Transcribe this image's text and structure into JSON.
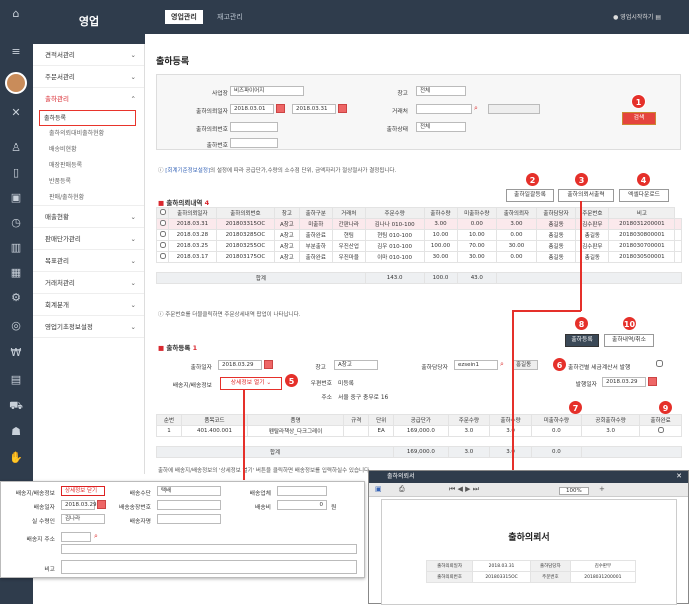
{
  "app": {
    "logo": "영업",
    "tabs": [
      "영업관리",
      "재고관리"
    ],
    "action": "영업시작하기"
  },
  "sidebar": [
    {
      "label": "견적서관리",
      "items": []
    },
    {
      "label": "주문서관리",
      "items": []
    },
    {
      "label": "출하관리",
      "items": [
        "출하등록",
        "출하의뢰대비출하현황",
        "배송비현황",
        "매장판매등록",
        "반품등록",
        "판매/출하현황"
      ]
    },
    {
      "label": "매출현황",
      "items": []
    },
    {
      "label": "판매단가관리",
      "items": []
    },
    {
      "label": "목표관리",
      "items": []
    },
    {
      "label": "거래처관리",
      "items": []
    },
    {
      "label": "회계분개",
      "items": []
    },
    {
      "label": "영업기초정보설정",
      "items": []
    }
  ],
  "page": {
    "title": "출하등록"
  },
  "search": {
    "biz_label": "사업장",
    "biz_value": "비즈파이어지",
    "warehouse_label": "창고",
    "warehouse_value": "전체",
    "date_label": "출하의뢰일자",
    "date_from": "2018.03.01",
    "date_to": "2018.03.31",
    "client_label": "거래처",
    "req_no_label": "출하의뢰번호",
    "status_label": "출하상태",
    "status_value": "전체",
    "ship_no_label": "출하번호",
    "search_btn": "검색"
  },
  "note1": {
    "link": "[회계기준정보설정]",
    "text": "의 설정에 따라 공급단가,수량의 소수점 단위, 금액자리가 절상절사가 결정됩니다."
  },
  "buttons": {
    "bulk": "출하일괄등록",
    "print": "출하의뢰서출력",
    "excel": "엑셀다운로드",
    "register": "출하등록",
    "cancel": "출하내역/취소"
  },
  "list": {
    "title": "출하의뢰내역",
    "count": "4",
    "headers": [
      "출하의뢰일자",
      "출하의뢰번호",
      "창고",
      "출하구분",
      "거래처",
      "주문수량",
      "출하수량",
      "미출하수량",
      "출하의뢰자",
      "출하담당자",
      "주문번호",
      "비고"
    ],
    "rows": [
      [
        "2018.03.31",
        "201803315OC",
        "A창고",
        "미출하",
        "간판나라",
        "김나나 010-100",
        "3.00",
        "0.00",
        "3.00",
        "총길동",
        "김수판무",
        "2018031200001",
        ""
      ],
      [
        "2018.03.28",
        "201803285OC",
        "A창고",
        "출하완료",
        "현팀",
        "현팀 010-100",
        "10.00",
        "10.00",
        "0.00",
        "총길동",
        "총길동",
        "2018030800001",
        ""
      ],
      [
        "2018.03.25",
        "201803255OC",
        "A창고",
        "부분출하",
        "우진산업",
        "김우 010-100",
        "100.00",
        "70.00",
        "30.00",
        "총길동",
        "김수판무",
        "2018030700001",
        ""
      ],
      [
        "2018.03.17",
        "201803175OC",
        "A창고",
        "출하완료",
        "우진마을",
        "이마 010-100",
        "30.00",
        "30.00",
        "0.00",
        "총길동",
        "총길동",
        "2018030500001",
        ""
      ]
    ],
    "total_label": "합계",
    "total": [
      "143.0",
      "100.0",
      "43.0"
    ]
  },
  "note2": "주문번호를 더블클릭하면 주문상세내역 팝업이 나타납니다.",
  "reg": {
    "title": "출하등록",
    "count": "1",
    "date_label": "출하일자",
    "date": "2018.03.29",
    "wh_label": "창고",
    "wh_value": "A창고",
    "mgr_label": "출하담당자",
    "mgr_id": "ezsein1",
    "mgr_name": "홍길동",
    "tax_label": "출하건별 세금계산서 발행",
    "issue_label": "발행일자",
    "issue_date": "2018.03.29",
    "delivery_label": "배송지/배송정보",
    "detail_btn": "상세정보 열기",
    "post_label": "우편번호",
    "post_value": "미등록",
    "addr_label": "주소",
    "addr_value": "서울 중구 충무로 16"
  },
  "items": {
    "headers": [
      "순번",
      "품목코드",
      "품명",
      "규격",
      "단위",
      "공급단가",
      "주문수량",
      "출하수량",
      "미출하수량",
      "공회출하수량",
      "출하완료"
    ],
    "row": [
      "1",
      "401.400.001",
      "펜탈라책상_다크그레이",
      "",
      "EA",
      "169,000.0",
      "3.0",
      "3.0",
      "0.0",
      "3.0",
      ""
    ],
    "total_label": "합계",
    "total": [
      "169,000.0",
      "3.0",
      "3.0",
      "0.0"
    ]
  },
  "note3": "출하에 배송지/배송정보의 '상세정보 열기' 버튼을 클릭하면 배송정보를 입력하실수 있습니다.",
  "popup1": {
    "f1": "배송지/배송정보",
    "f1v": "상세정보 닫기",
    "f2": "배송수단",
    "f2v": "택배",
    "f3": "배송업체",
    "f4": "배송일자",
    "f4v": "2018.03.29",
    "f5": "배송송장번호",
    "f6": "배송비",
    "f6v": "0",
    "f6u": "원",
    "f7": "실 수령인",
    "f7v": "김나라",
    "f8": "배송자명",
    "f9": "배송지 주소",
    "f10": "비고"
  },
  "popup2": {
    "title": "출하의뢰서",
    "doc_title": "출하의뢰서",
    "zoom": "100%",
    "r1": [
      "출하의뢰일자",
      "2018.03.31",
      "출하담당자",
      "김수판무"
    ],
    "r2": [
      "출하의뢰번호",
      "201803315OC",
      "주문번호",
      "2018031200001"
    ]
  },
  "markers": [
    "1",
    "2",
    "3",
    "4",
    "5",
    "6",
    "7",
    "8",
    "9",
    "10"
  ]
}
